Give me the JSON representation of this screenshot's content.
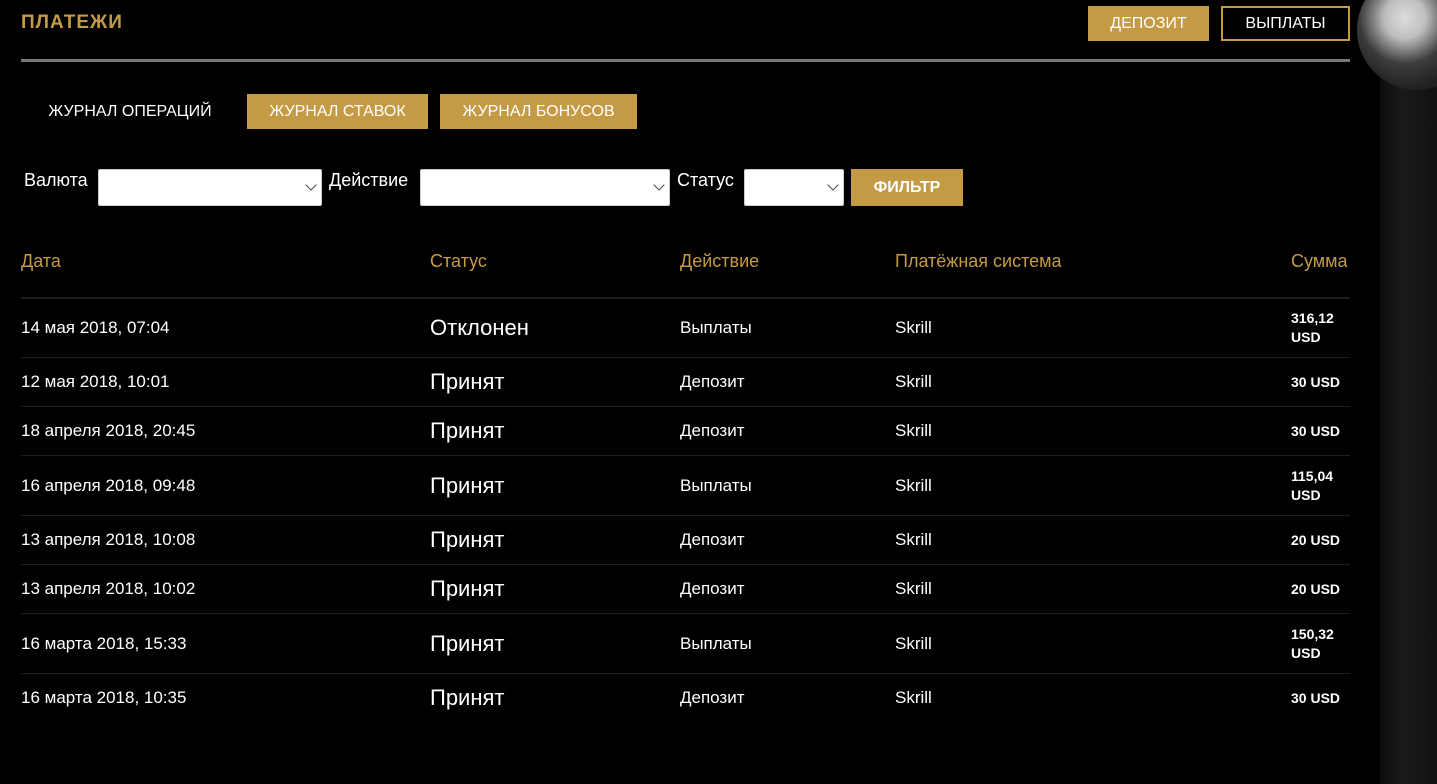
{
  "header": {
    "title": "ПЛАТЕЖИ",
    "deposit_label": "ДЕПОЗИТ",
    "payouts_label": "ВЫПЛАТЫ"
  },
  "tabs": [
    {
      "label": "ЖУРНАЛ ОПЕРАЦИЙ"
    },
    {
      "label": "ЖУРНАЛ СТАВОК"
    },
    {
      "label": "ЖУРНАЛ БОНУСОВ"
    }
  ],
  "filters": {
    "currency_label": "Валюта",
    "currency_value": "",
    "action_label": "Действие",
    "action_value": "",
    "status_label": "Статус",
    "status_value": "",
    "filter_button": "ФИЛЬТР"
  },
  "table": {
    "columns": [
      "Дата",
      "Статус",
      "Действие",
      "Платёжная система",
      "Сумма"
    ],
    "rows": [
      {
        "date": "14 мая 2018, 07:04",
        "status": "Отклонен",
        "action": "Выплаты",
        "system": "Skrill",
        "sum": "316,12 USD"
      },
      {
        "date": "12 мая 2018, 10:01",
        "status": "Принят",
        "action": "Депозит",
        "system": "Skrill",
        "sum": "30 USD"
      },
      {
        "date": "18 апреля 2018, 20:45",
        "status": "Принят",
        "action": "Депозит",
        "system": "Skrill",
        "sum": "30 USD"
      },
      {
        "date": "16 апреля 2018, 09:48",
        "status": "Принят",
        "action": "Выплаты",
        "system": "Skrill",
        "sum": "115,04 USD"
      },
      {
        "date": "13 апреля 2018, 10:08",
        "status": "Принят",
        "action": "Депозит",
        "system": "Skrill",
        "sum": "20 USD"
      },
      {
        "date": "13 апреля 2018, 10:02",
        "status": "Принят",
        "action": "Депозит",
        "system": "Skrill",
        "sum": "20 USD"
      },
      {
        "date": "16 марта 2018, 15:33",
        "status": "Принят",
        "action": "Выплаты",
        "system": "Skrill",
        "sum": "150,32 USD"
      },
      {
        "date": "16 марта 2018, 10:35",
        "status": "Принят",
        "action": "Депозит",
        "system": "Skrill",
        "sum": "30 USD"
      }
    ]
  },
  "colors": {
    "accent": "#c59a45",
    "background": "#000000",
    "text": "#ffffff",
    "divider": "#777777"
  }
}
